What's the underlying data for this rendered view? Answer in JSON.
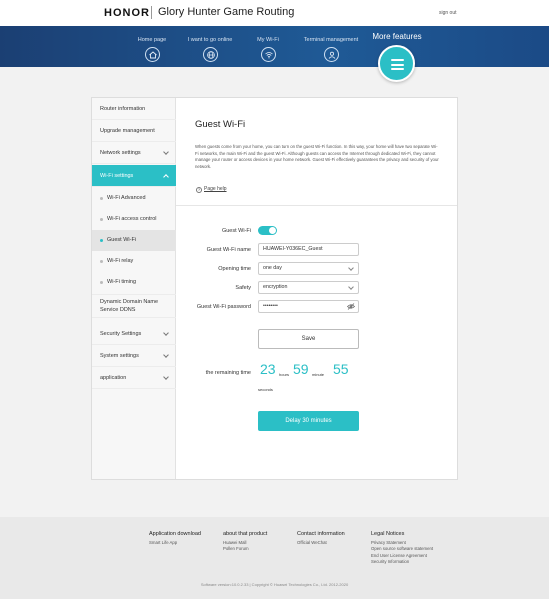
{
  "header": {
    "brand": "HONOR",
    "product": "Glory Hunter Game Routing",
    "signout": "sign out"
  },
  "nav": {
    "items": [
      {
        "label": "Home page",
        "icon": "home-icon"
      },
      {
        "label": "I want to go online",
        "icon": "globe-icon"
      },
      {
        "label": "My Wi-Fi",
        "icon": "wifi-icon"
      },
      {
        "label": "Terminal management",
        "icon": "user-icon"
      }
    ],
    "more": "More features",
    "accent": "#2bbfc6",
    "band_color": "#1d4f8a"
  },
  "sidebar": {
    "items": [
      {
        "label": "Router information"
      },
      {
        "label": "Upgrade management"
      },
      {
        "label": "Network settings"
      },
      {
        "label": "Wi-Fi settings"
      }
    ],
    "sub": [
      {
        "label": "Wi-Fi Advanced"
      },
      {
        "label": "Wi-Fi access control"
      },
      {
        "label": "Guest Wi-Fi"
      },
      {
        "label": "Wi-Fi relay"
      },
      {
        "label": "Wi-Fi timing"
      }
    ],
    "ddns_line1": "Dynamic Domain Name",
    "ddns_line2": "Service DDNS",
    "bottom": [
      {
        "label": "Security Settings"
      },
      {
        "label": "System settings"
      },
      {
        "label": "application"
      }
    ]
  },
  "page": {
    "title": "Guest Wi-Fi",
    "description": "When guests come from your home, you can turn on the guest Wi-Fi function. In this way, your home will have two separate Wi-Fi networks, the main Wi-Fi and the guest Wi-Fi. Although guests can access the Internet through dedicated Wi-Fi, they cannot manage your router or access devices in your home network. Guest Wi-Fi effectively guarantees the privacy and security of your network.",
    "help": "Page help"
  },
  "form": {
    "guest_wifi_label": "Guest Wi-Fi",
    "guest_wifi_enabled": true,
    "name_label": "Guest Wi-Fi name",
    "name_value": "HUAWEI-Y036EC_Guest",
    "opening_label": "Opening time",
    "opening_value": "one day",
    "safety_label": "Safety",
    "safety_value": "encryption",
    "password_label": "Guest Wi-Fi password",
    "password_value": "••••••••",
    "save": "Save",
    "remaining_label": "the remaining time",
    "hours": "23",
    "hours_unit": "hours",
    "minutes": "59",
    "minutes_unit": "minute",
    "seconds": "55",
    "seconds_unit": "seconds",
    "delay": "Delay 30 minutes"
  },
  "footer": {
    "col1": {
      "title": "Application download",
      "links": [
        "Smart Life App"
      ]
    },
    "col2": {
      "title": "about that product",
      "links": [
        "Huawei Mall",
        "Pollen Forum"
      ]
    },
    "col3": {
      "title": "Contact information",
      "links": [
        "Official WeChat"
      ]
    },
    "col4": {
      "title": "Legal Notices",
      "links": [
        "Privacy Statement",
        "Open source software statement",
        "End User License Agreement",
        "Security Information"
      ]
    },
    "copyright": "Software version:10.0.2.33 | Copyright © Huawei Technologies Co., Ltd. 2012-2020"
  }
}
